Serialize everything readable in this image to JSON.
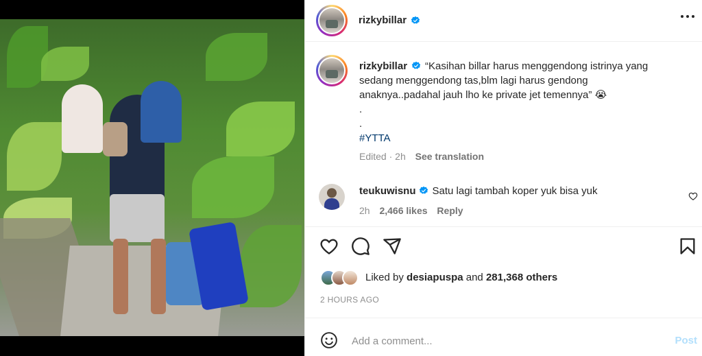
{
  "post": {
    "author": "rizkybillar",
    "caption_lines": [
      "“Kasihan billar harus menggendong istrinya yang",
      "sedang menggendong tas,blm lagi harus gendong",
      "anaknya..padahal jauh lho ke private jet temennya”"
    ],
    "caption_emoji": "😭",
    "dot1": ".",
    "dot2": ".",
    "hashtag": "#YTTA",
    "edited": "Edited",
    "separator": "·",
    "age": "2h",
    "see_translation": "See translation"
  },
  "comment": {
    "author": "teukuwisnu",
    "text": "Satu lagi tambah koper yuk bisa yuk",
    "age": "2h",
    "likes": "2,466 likes",
    "reply": "Reply"
  },
  "likes": {
    "prefix": "Liked by",
    "first_user": "desiapuspa",
    "and": "and",
    "others": "281,368 others"
  },
  "timestamp": "2 HOURS AGO",
  "composer": {
    "placeholder": "Add a comment...",
    "post_label": "Post"
  },
  "colors": {
    "verified": "#0095f6",
    "post_disabled": "#b2dffc",
    "link": "#00376b"
  },
  "icons": [
    "verified-badge-icon",
    "more-options-icon",
    "heart-icon",
    "comment-icon",
    "share-icon",
    "bookmark-icon",
    "emoji-icon"
  ]
}
